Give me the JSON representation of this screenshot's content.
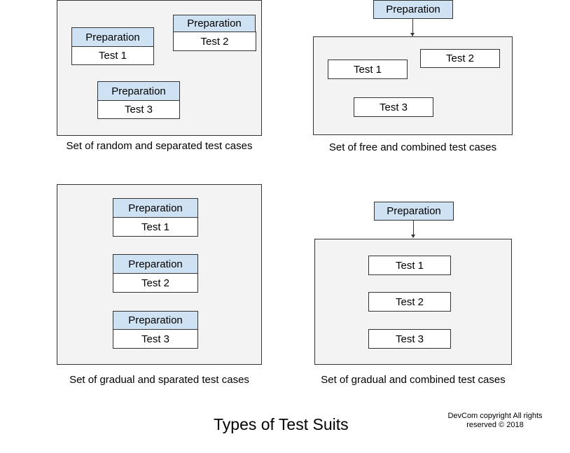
{
  "colors": {
    "panel_bg": "#f3f3f3",
    "preparation_bg": "#cfe2f3",
    "test_bg": "#ffffff",
    "border": "#333333"
  },
  "diagrams": [
    {
      "id": "random-separated",
      "caption": "Set of random and separated test cases",
      "units": [
        {
          "preparation": "Preparation",
          "test": "Test 1"
        },
        {
          "preparation": "Preparation",
          "test": "Test 2"
        },
        {
          "preparation": "Preparation",
          "test": "Test 3"
        }
      ]
    },
    {
      "id": "free-combined",
      "caption": "Set of free and combined test cases",
      "preparation": "Preparation",
      "tests": [
        "Test 1",
        "Test 2",
        "Test 3"
      ]
    },
    {
      "id": "gradual-separated",
      "caption": "Set of gradual and sparated test cases",
      "units": [
        {
          "preparation": "Preparation",
          "test": "Test 1"
        },
        {
          "preparation": "Preparation",
          "test": "Test 2"
        },
        {
          "preparation": "Preparation",
          "test": "Test 3"
        }
      ]
    },
    {
      "id": "gradual-combined",
      "caption": "Set of gradual and combined test cases",
      "preparation": "Preparation",
      "tests": [
        "Test 1",
        "Test 2",
        "Test 3"
      ]
    }
  ],
  "title": "Types of Test Suits",
  "copyright": {
    "line1": "DevCom copyright All rights",
    "line2": "reserved © 2018"
  }
}
